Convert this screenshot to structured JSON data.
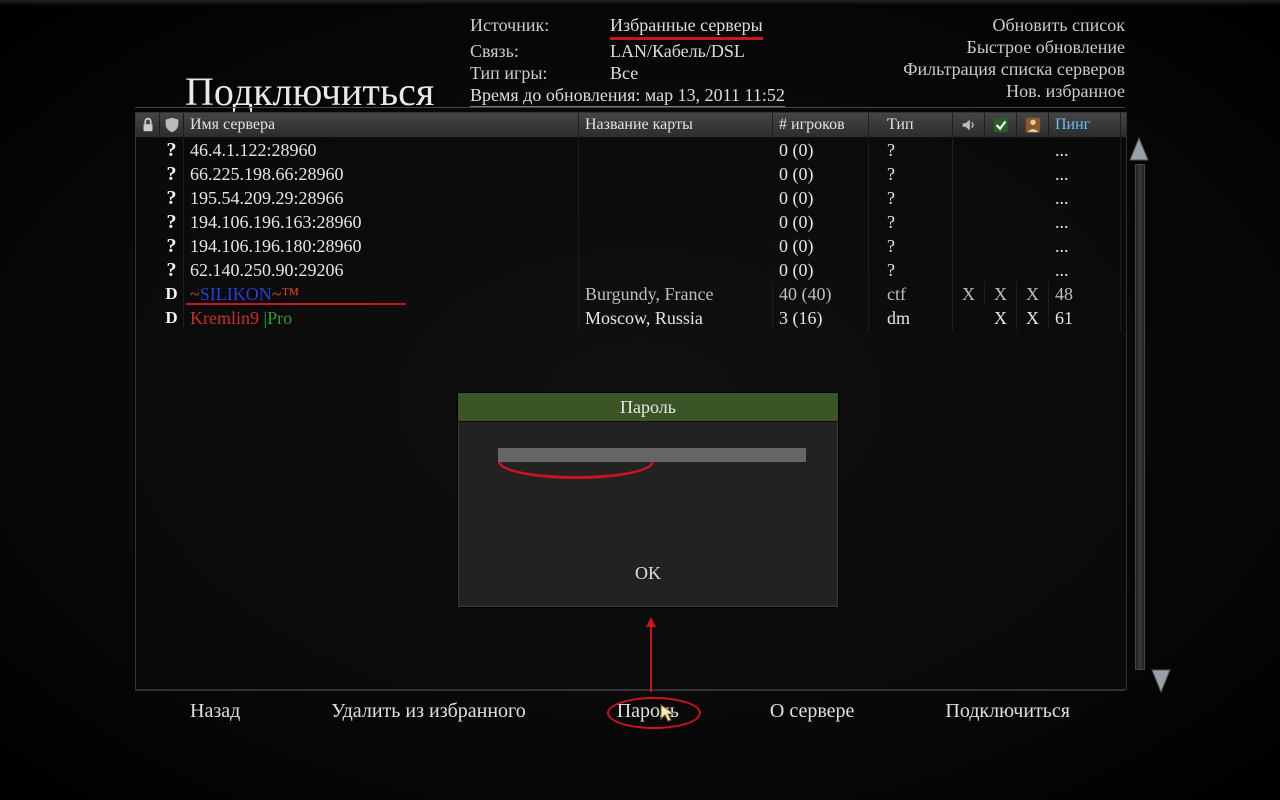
{
  "title": "Подключиться",
  "info": {
    "source_label": "Источник:",
    "source_value": "Избранные серверы",
    "conn_label": "Связь:",
    "conn_value": "LAN/Кабель/DSL",
    "gtype_label": "Тип игры:",
    "gtype_value": "Все",
    "upd_label": "Время до обновления: мар 13, 2011   11:52"
  },
  "right_menu": {
    "refresh": "Обновить список",
    "quick": "Быстрое обновление",
    "filter": "Фильтрация списка серверов",
    "newfav": "Нов. избранное"
  },
  "columns": {
    "name": "Имя сервера",
    "map": "Название карты",
    "players": "# игроков",
    "type": "Тип",
    "ping": "Пинг"
  },
  "rows": [
    {
      "icon": "?",
      "name": "46.4.1.122:28960",
      "map": "",
      "players": "0 (0)",
      "type": "?",
      "vox": "",
      "pb": "",
      "kill": "",
      "ping": "..."
    },
    {
      "icon": "?",
      "name": "66.225.198.66:28960",
      "map": "",
      "players": "0 (0)",
      "type": "?",
      "vox": "",
      "pb": "",
      "kill": "",
      "ping": "..."
    },
    {
      "icon": "?",
      "name": "195.54.209.29:28966",
      "map": "",
      "players": "0 (0)",
      "type": "?",
      "vox": "",
      "pb": "",
      "kill": "",
      "ping": "..."
    },
    {
      "icon": "?",
      "name": "194.106.196.163:28960",
      "map": "",
      "players": "0 (0)",
      "type": "?",
      "vox": "",
      "pb": "",
      "kill": "",
      "ping": "..."
    },
    {
      "icon": "?",
      "name": "194.106.196.180:28960",
      "map": "",
      "players": "0 (0)",
      "type": "?",
      "vox": "",
      "pb": "",
      "kill": "",
      "ping": "..."
    },
    {
      "icon": "?",
      "name": "62.140.250.90:29206",
      "map": "",
      "players": "0 (0)",
      "type": "?",
      "vox": "",
      "pb": "",
      "kill": "",
      "ping": "..."
    },
    {
      "icon": "D",
      "name_html": "silikon",
      "map": "Burgundy, France",
      "players": "40 (40)",
      "type": "ctf",
      "vox": "X",
      "pb": "X",
      "kill": "X",
      "ping": "48",
      "selected": true
    },
    {
      "icon": "D",
      "name_html": "kremlin",
      "map": "Moscow, Russia",
      "players": "3 (16)",
      "type": "dm",
      "vox": "",
      "pb": "X",
      "kill": "X",
      "ping": "61"
    }
  ],
  "special_names": {
    "silikon_prefix": "~",
    "silikon_main": "SILIKON",
    "silikon_suffix": "~™",
    "kremlin_a": "Kremlin9 ",
    "kremlin_b": "|Pro"
  },
  "dialog": {
    "title": "Пароль",
    "input_value": "",
    "ok": "OK"
  },
  "footer": {
    "back": "Назад",
    "delete": "Удалить из избранного",
    "password": "Пароль",
    "about": "О сервере",
    "connect": "Подключиться"
  },
  "icons": {
    "lock": "lock-icon",
    "shield": "shield-icon",
    "speaker": "speaker-icon",
    "check": "check-icon",
    "person": "person-icon"
  }
}
